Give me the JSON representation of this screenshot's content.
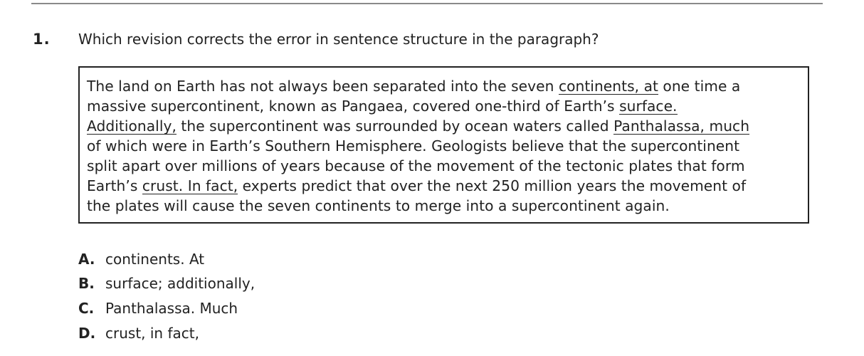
{
  "question": {
    "number": "1.",
    "stem": "Which revision corrects the error in sentence structure in the paragraph?"
  },
  "passage": {
    "lines": [
      [
        {
          "text": "The land on Earth has not always been separated into the seven "
        },
        {
          "text": "continents, at",
          "underlined": true
        },
        {
          "text": " one time a"
        }
      ],
      [
        {
          "text": "massive supercontinent, known as Pangaea, covered one-third of Earth’s "
        },
        {
          "text": "surface.",
          "underlined": true
        }
      ],
      [
        {
          "text": "Additionally,",
          "underlined": true
        },
        {
          "text": " the supercontinent was surrounded by ocean waters called "
        },
        {
          "text": "Panthalassa, much",
          "underlined": true
        }
      ],
      [
        {
          "text": "of which were in Earth’s Southern Hemisphere. Geologists believe that the supercontinent"
        }
      ],
      [
        {
          "text": "split apart over millions of years because of the movement of the tectonic plates that form"
        }
      ],
      [
        {
          "text": "Earth’s "
        },
        {
          "text": "crust. In fact,",
          "underlined": true
        },
        {
          "text": " experts predict that over the next 250 million years the movement of"
        }
      ],
      [
        {
          "text": "the plates will cause the seven continents to merge into a supercontinent again."
        }
      ]
    ]
  },
  "answers": [
    {
      "letter": "A.",
      "text": "continents. At"
    },
    {
      "letter": "B.",
      "text": "surface; additionally,"
    },
    {
      "letter": "C.",
      "text": "Panthalassa. Much"
    },
    {
      "letter": "D.",
      "text": "crust, in fact,"
    }
  ]
}
